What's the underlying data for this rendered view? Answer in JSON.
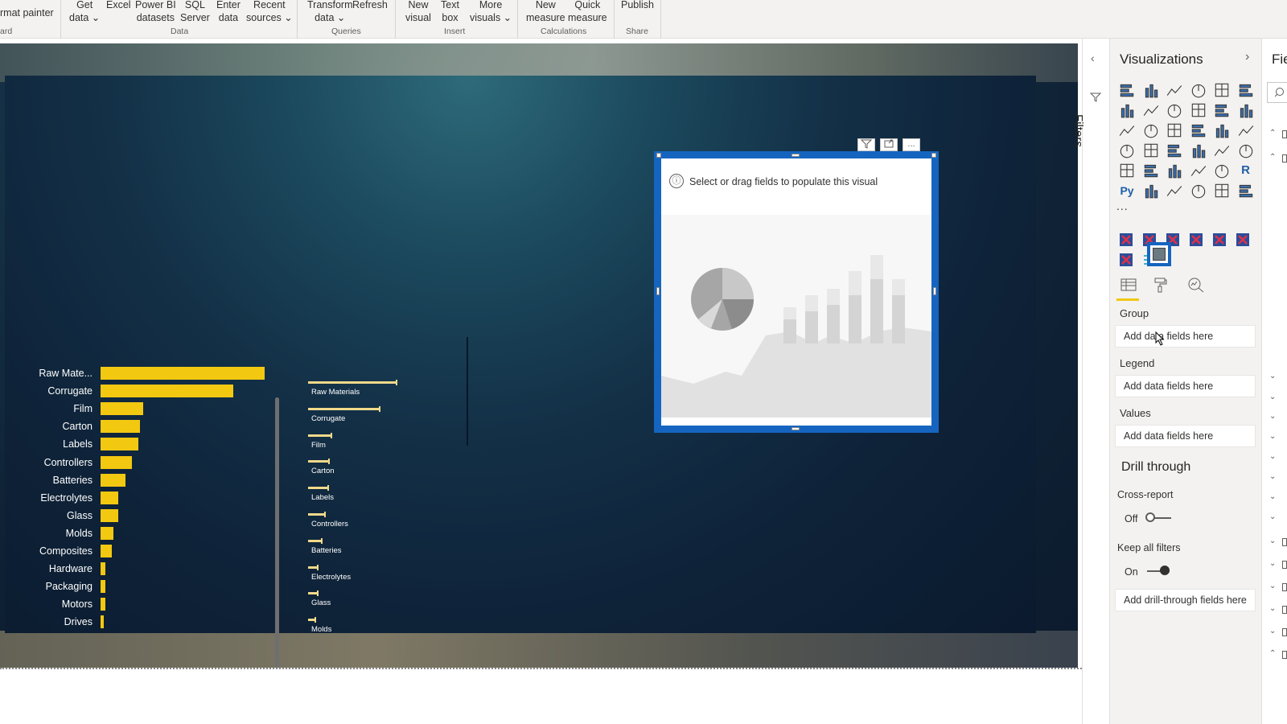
{
  "ribbon": {
    "groups": [
      {
        "caption": "ard",
        "buttons": [
          {
            "label": "rmat painter"
          }
        ]
      },
      {
        "caption": "Data",
        "buttons": [
          {
            "label": "Get\ndata ⌄"
          },
          {
            "label": "Excel"
          },
          {
            "label": "Power BI\ndatasets"
          },
          {
            "label": "SQL\nServer"
          },
          {
            "label": "Enter\ndata"
          },
          {
            "label": "Recent\nsources ⌄"
          }
        ]
      },
      {
        "caption": "Queries",
        "buttons": [
          {
            "label": "Transform\ndata ⌄"
          },
          {
            "label": "Refresh"
          }
        ]
      },
      {
        "caption": "Insert",
        "buttons": [
          {
            "label": "New\nvisual"
          },
          {
            "label": "Text\nbox"
          },
          {
            "label": "More\nvisuals ⌄"
          }
        ]
      },
      {
        "caption": "Calculations",
        "buttons": [
          {
            "label": "New\nmeasure"
          },
          {
            "label": "Quick\nmeasure"
          }
        ]
      },
      {
        "caption": "Share",
        "buttons": [
          {
            "label": "Publish"
          }
        ]
      }
    ]
  },
  "bar_chart": {
    "type": "bar",
    "categories": [
      "Raw Mate...",
      "Corrugate",
      "Film",
      "Carton",
      "Labels",
      "Controllers",
      "Batteries",
      "Electrolytes",
      "Glass",
      "Molds",
      "Composites",
      "Hardware",
      "Packaging",
      "Motors",
      "Drives"
    ],
    "values": [
      100,
      81,
      26,
      24,
      23,
      19,
      15,
      11,
      11,
      8,
      7,
      3,
      3,
      3,
      2
    ],
    "color": "#f2c811"
  },
  "line_bar_chart": {
    "type": "bar",
    "categories": [
      "Raw Materials",
      "Corrugate",
      "Film",
      "Carton",
      "Labels",
      "Controllers",
      "Batteries",
      "Electrolytes",
      "Glass",
      "Molds"
    ],
    "values": [
      100,
      81,
      26,
      24,
      23,
      19,
      15,
      11,
      11,
      8
    ],
    "color": "#f0d98a"
  },
  "placeholder_visual": {
    "message": "Select or drag fields to populate this visual",
    "info_icon": "ⓘ"
  },
  "visual_header": {
    "filter_icon": "filter-icon",
    "focus_icon": "focus-mode-icon",
    "more_label": "..."
  },
  "filters": {
    "label": "Filters"
  },
  "visualizations": {
    "title": "Visualizations",
    "more_label": "...",
    "wells": {
      "group": {
        "label": "Group",
        "placeholder": "Add data fields here"
      },
      "legend": {
        "label": "Legend",
        "placeholder": "Add data fields here"
      },
      "values": {
        "label": "Values",
        "placeholder": "Add data fields here"
      }
    },
    "drill_through": {
      "title": "Drill through",
      "cross_report": {
        "label": "Cross-report",
        "state": "Off"
      },
      "keep_all_filters": {
        "label": "Keep all filters",
        "state": "On"
      },
      "placeholder": "Add drill-through fields here"
    }
  },
  "fields": {
    "title": "Fie"
  },
  "colors": {
    "accent": "#1565c0",
    "bar": "#f2c811",
    "selection_underline": "#f2c811"
  }
}
